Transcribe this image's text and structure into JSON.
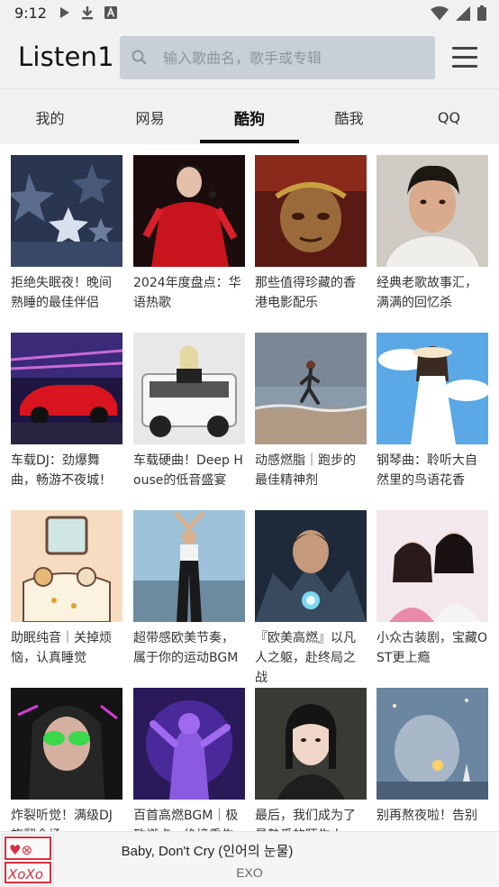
{
  "status_bar": {
    "time": "9:12",
    "left_icons": [
      "play-icon",
      "download-icon",
      "a-box-icon"
    ],
    "right_icons": [
      "wifi-icon",
      "signal-icon",
      "battery-icon"
    ]
  },
  "header": {
    "app_title": "Listen1",
    "search_placeholder": "输入歌曲名，歌手或专辑",
    "menu_icon": "hamburger-menu-icon"
  },
  "tabs": [
    {
      "label": "我的",
      "active": false
    },
    {
      "label": "网易",
      "active": false
    },
    {
      "label": "酷狗",
      "active": true
    },
    {
      "label": "酷我",
      "active": false
    },
    {
      "label": "QQ",
      "active": false
    }
  ],
  "playlists": [
    {
      "title": "拒绝失眠夜！晚间熟睡的最佳伴侣",
      "cover": "night-stars-cover"
    },
    {
      "title": "2024年度盘点：华语热歌",
      "cover": "red-dress-singer-cover"
    },
    {
      "title": "那些值得珍藏的香港电影配乐",
      "cover": "monkey-king-cover"
    },
    {
      "title": "经典老歌故事汇，满满的回忆杀",
      "cover": "male-singer-portrait-cover"
    },
    {
      "title": "车载DJ：劲爆舞曲，畅游不夜城！",
      "cover": "red-sports-car-cover"
    },
    {
      "title": "车载硬曲！Deep House的低音盛宴",
      "cover": "white-suv-cover"
    },
    {
      "title": "动感燃脂｜跑步的最佳精神剂",
      "cover": "beach-runner-cover"
    },
    {
      "title": "钢琴曲：聆听大自然里的鸟语花香",
      "cover": "anime-girl-sky-cover"
    },
    {
      "title": "助眠纯音｜关掉烦恼，认真睡觉",
      "cover": "cartoon-bedroom-cover"
    },
    {
      "title": "超带感欧美节奏，属于你的运动BGM",
      "cover": "fitness-woman-cover"
    },
    {
      "title": "『欧美高燃』以凡人之躯，赴终局之战",
      "cover": "iron-man-cover"
    },
    {
      "title": "小众古装剧，宝藏OST更上瘾",
      "cover": "costume-drama-couple-cover"
    },
    {
      "title": "炸裂听觉！满级DJ旋翻全场",
      "cover": "neon-sunglasses-girl-cover"
    },
    {
      "title": "百首高燃BGM｜极致燃点，绝境重生",
      "cover": "purple-warrior-cover"
    },
    {
      "title": "最后，我们成为了最熟悉的陌生人",
      "cover": "short-hair-girl-cover"
    },
    {
      "title": "别再熬夜啦！告别",
      "cover": "bear-night-sky-cover"
    }
  ],
  "player": {
    "title": "Baby, Don't Cry (인어의 눈물)",
    "artist": "EXO",
    "cover": "exo-logo-cover"
  },
  "colors": {
    "header_bg": "#f1f1f1",
    "search_bg": "#c9cfd6",
    "placeholder": "#8c949c",
    "tab_indicator": "#111111",
    "player_bg": "#f5f5f5"
  }
}
